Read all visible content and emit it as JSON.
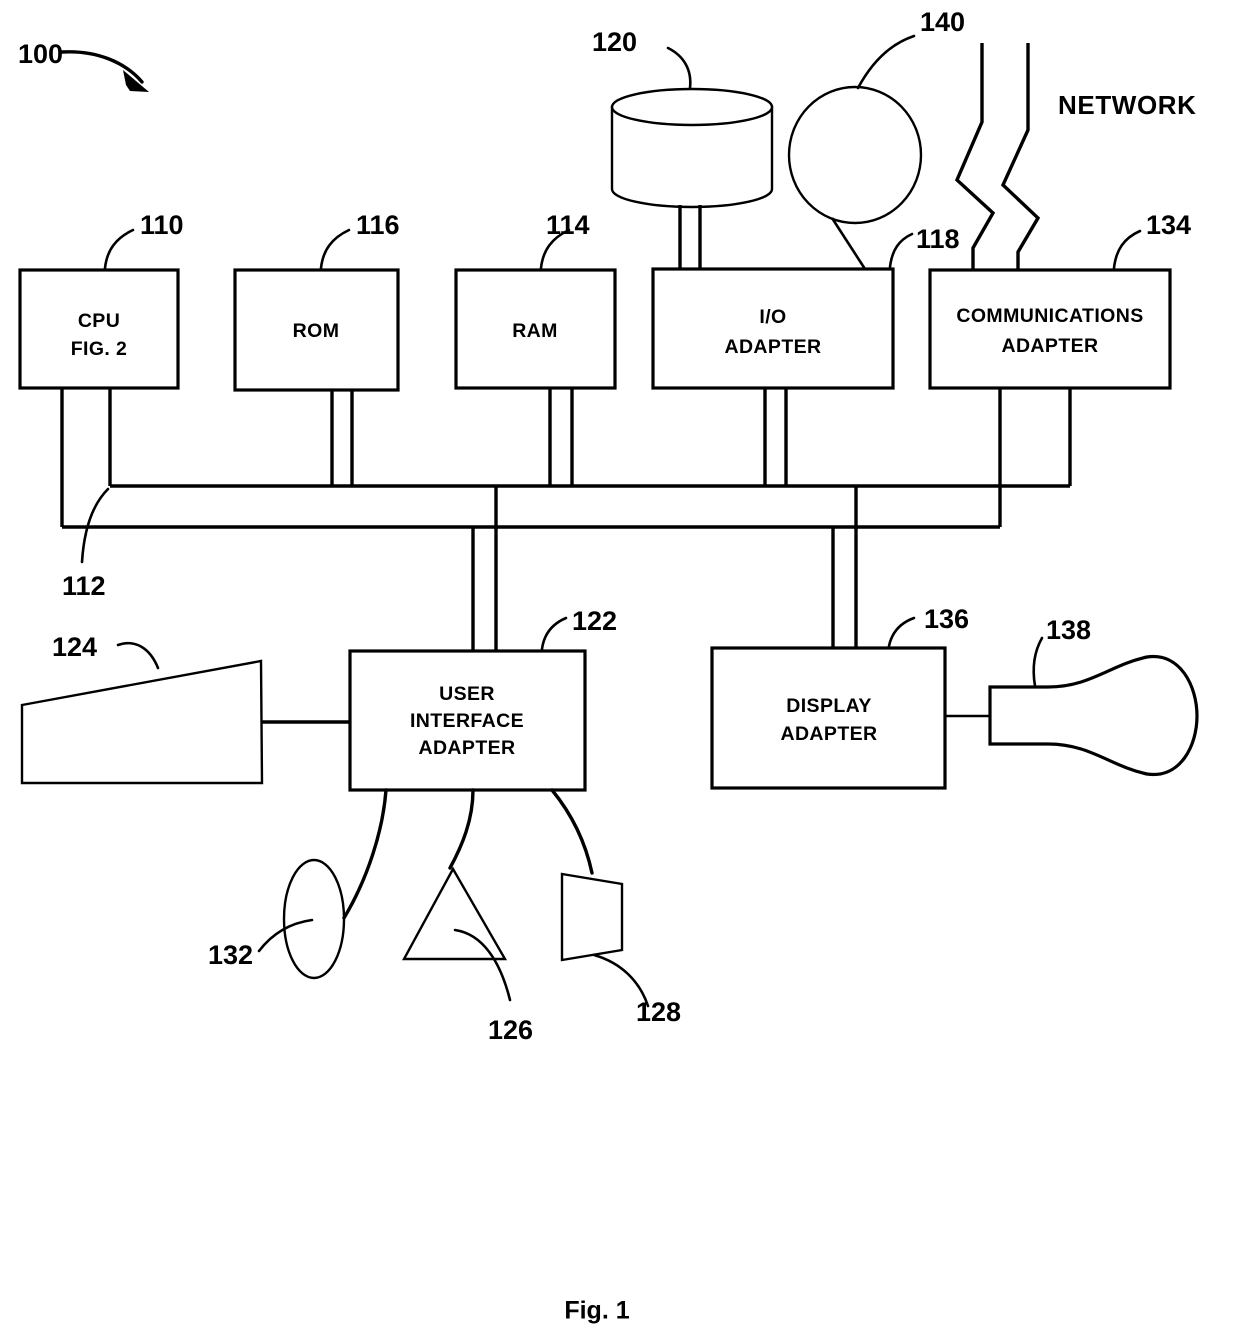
{
  "figure": {
    "caption": "Fig. 1",
    "system_reference": "100"
  },
  "blocks": [
    {
      "id": "cpu",
      "ref": "110",
      "lines": [
        "CPU",
        "FIG. 2"
      ]
    },
    {
      "id": "rom",
      "ref": "116",
      "lines": [
        "ROM"
      ]
    },
    {
      "id": "ram",
      "ref": "114",
      "lines": [
        "RAM"
      ]
    },
    {
      "id": "io",
      "ref": "118",
      "lines": [
        "I/O",
        "ADAPTER"
      ]
    },
    {
      "id": "comms",
      "ref": "134",
      "lines": [
        "COMMUNICATIONS",
        "ADAPTER"
      ]
    },
    {
      "id": "ui",
      "ref": "122",
      "lines": [
        "USER",
        "INTERFACE",
        "ADAPTER"
      ]
    },
    {
      "id": "display",
      "ref": "136",
      "lines": [
        "DISPLAY",
        "ADAPTER"
      ]
    }
  ],
  "peripherals": [
    {
      "id": "disk",
      "ref": "120",
      "icon": "disk-cylinder-icon"
    },
    {
      "id": "tape",
      "ref": "140",
      "icon": "tape-reel-circle-icon"
    },
    {
      "id": "keyboard",
      "ref": "124",
      "icon": "keyboard-icon"
    },
    {
      "id": "trackball",
      "ref": "132",
      "icon": "trackball-ellipse-icon"
    },
    {
      "id": "mouse",
      "ref": "126",
      "icon": "mouse-triangle-icon"
    },
    {
      "id": "speaker",
      "ref": "128",
      "icon": "speaker-icon"
    },
    {
      "id": "monitor",
      "ref": "138",
      "icon": "crt-monitor-icon"
    }
  ],
  "bus": {
    "ref": "112"
  },
  "network": {
    "label": "NETWORK",
    "icon": "network-break-lines-icon"
  },
  "style": {
    "stroke": "#000000",
    "background": "#ffffff"
  }
}
